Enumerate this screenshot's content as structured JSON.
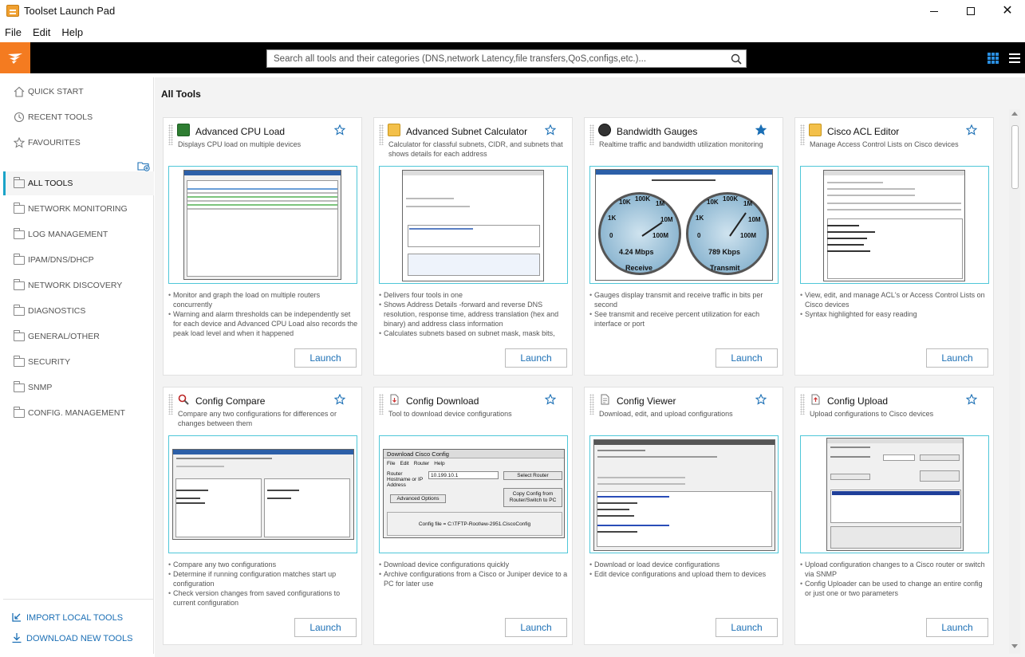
{
  "window": {
    "title": "Toolset Launch Pad"
  },
  "menu": [
    "File",
    "Edit",
    "Help"
  ],
  "search": {
    "placeholder": "Search all tools and their categories (DNS,network Latency,file transfers,QoS,configs,etc.)..."
  },
  "colors": {
    "brand": "#f47b20",
    "accent": "#1aa3c8",
    "link": "#1b6fb5"
  },
  "sidebar": {
    "top_items": [
      {
        "label": "QUICK START",
        "icon": "home-icon"
      },
      {
        "label": "RECENT TOOLS",
        "icon": "clock-icon"
      },
      {
        "label": "FAVOURITES",
        "icon": "star-icon"
      }
    ],
    "categories": [
      "ALL TOOLS",
      "NETWORK MONITORING",
      "LOG MANAGEMENT",
      "IPAM/DNS/DHCP",
      "NETWORK DISCOVERY",
      "DIAGNOSTICS",
      "GENERAL/OTHER",
      "SECURITY",
      "SNMP",
      "CONFIG. MANAGEMENT"
    ],
    "active_category": "ALL TOOLS",
    "import_label": "IMPORT LOCAL TOOLS",
    "download_label": "DOWNLOAD NEW TOOLS"
  },
  "main": {
    "title": "All Tools",
    "launch_label": "Launch",
    "cards": [
      {
        "title": "Advanced CPU Load",
        "desc": "Displays CPU load on multiple devices",
        "favourite": false,
        "bullets": [
          "Monitor and graph the load on multiple routers concurrently",
          "Warning and alarm thresholds can be independently set for each device and Advanced CPU Load also records the peak load level and when it happened"
        ]
      },
      {
        "title": "Advanced Subnet Calculator",
        "desc": "Calculator for classful subnets, CIDR, and subnets that shows details for each address",
        "favourite": false,
        "bullets": [
          "Delivers four tools in one",
          "Shows Address Details -forward and reverse DNS resolution, response time, address translation (hex and binary) and address class information",
          "Calculates subnets based on subnet mask, mask bits, host bits, number of subnets and hosts per subnet"
        ]
      },
      {
        "title": "Bandwidth Gauges",
        "desc": "Realtime traffic and bandwidth utilization monitoring",
        "favourite": true,
        "bullets": [
          "Gauges display transmit and receive traffic in bits per second",
          "See transmit and receive percent utilization for each interface or port"
        ],
        "gauges": [
          {
            "label": "Receive",
            "readout": "4.24 Mbps"
          },
          {
            "label": "Transmit",
            "readout": "789 Kbps"
          }
        ],
        "gauge_ticks": [
          "1K",
          "10K",
          "100K",
          "1M",
          "10M",
          "100M",
          "0"
        ]
      },
      {
        "title": "Cisco ACL Editor",
        "desc": "Manage Access Control Lists on Cisco devices",
        "favourite": false,
        "bullets": [
          "View, edit, and manage ACL's or Access Control Lists on Cisco devices",
          "Syntax highlighted for easy reading"
        ]
      },
      {
        "title": "Config Compare",
        "desc": "Compare any two configurations for differences or changes between them",
        "favourite": false,
        "bullets": [
          "Compare any two configurations",
          "Determine if running configuration matches start up configuration",
          "Check version changes from saved configurations to current configuration"
        ]
      },
      {
        "title": "Config Download",
        "desc": "Tool to download device configurations",
        "favourite": false,
        "bullets": [
          "Download device configurations quickly",
          "Archive configurations from a Cisco or Juniper device to a PC for later use"
        ],
        "mock": {
          "window_title": "Download Cisco Config",
          "menu": [
            "File",
            "Edit",
            "Router",
            "Help"
          ],
          "field_label": "Router Hostname or IP Address",
          "field_value": "10.199.10.1",
          "btn_select": "Select Router",
          "btn_advanced": "Advanced Options",
          "btn_copy": "Copy Config from Router/Switch to PC",
          "status": "Config file = C:\\TFTP-Root\\ew-2951.CiscoConfig"
        }
      },
      {
        "title": "Config Viewer",
        "desc": "Download, edit, and upload configurations",
        "favourite": false,
        "bullets": [
          "Download or load device configurations",
          "Edit device configurations and upload them to devices"
        ]
      },
      {
        "title": "Config Upload",
        "desc": "Upload configurations to Cisco devices",
        "favourite": false,
        "bullets": [
          "Upload configuration changes to a Cisco router or switch via SNMP",
          "Config Uploader can be used to change an entire config or just one or two parameters"
        ]
      }
    ]
  }
}
